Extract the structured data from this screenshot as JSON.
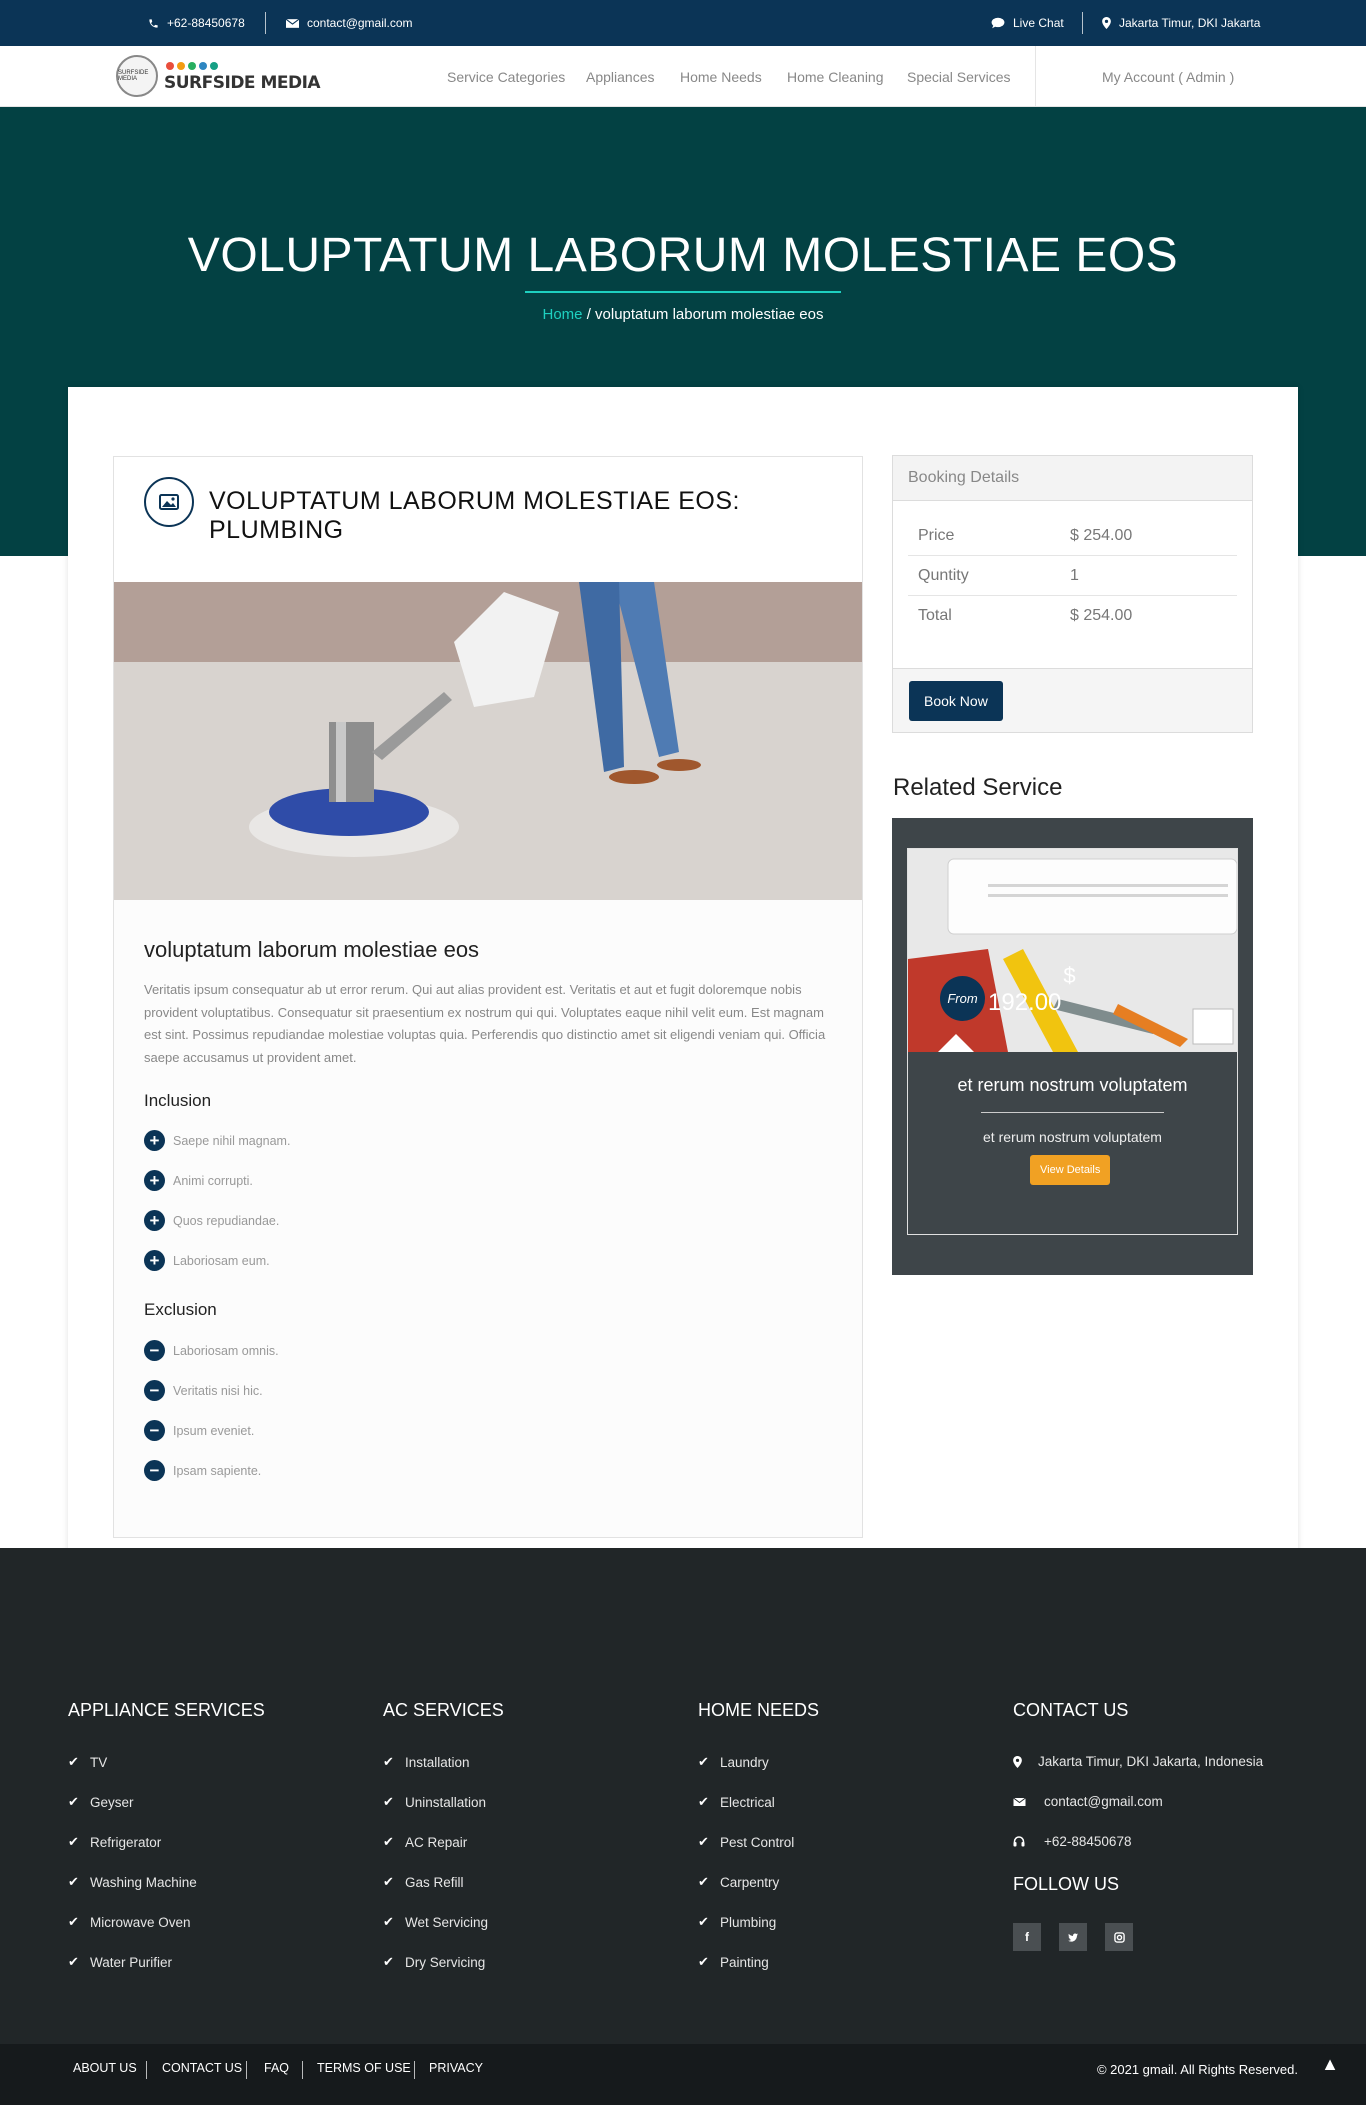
{
  "topbar": {
    "phone": "+62-88450678",
    "email": "contact@gmail.com",
    "live_chat": "Live Chat",
    "location": "Jakarta Timur, DKI Jakarta"
  },
  "brand": {
    "name": "SURFSIDE MEDIA",
    "badge": "SURFSIDE MEDIA"
  },
  "nav": {
    "items": [
      "Service Categories",
      "Appliances",
      "Home Needs",
      "Home Cleaning",
      "Special Services"
    ],
    "account": "My Account ( Admin )"
  },
  "hero": {
    "title": "VOLUPTATUM LABORUM MOLESTIAE EOS",
    "breadcrumb_home": "Home",
    "breadcrumb_current": "voluptatum laborum molestiae eos"
  },
  "service": {
    "title_line1": "VOLUPTATUM LABORUM MOLESTIAE EOS:",
    "title_line2": "PLUMBING",
    "subtitle": "voluptatum laborum molestiae eos",
    "description": "Veritatis ipsum consequatur ab ut error rerum. Qui aut alias provident est. Veritatis et aut et fugit doloremque nobis provident voluptatibus. Consequatur sit praesentium ex nostrum qui qui. Voluptates eaque nihil velit eum. Est magnam est sint. Possimus repudiandae molestiae voluptas quia. Perferendis quo distinctio amet sit eligendi veniam qui. Officia saepe accusamus ut provident amet.",
    "inclusion_title": "Inclusion",
    "inclusions": [
      "Saepe nihil magnam.",
      "Animi corrupti.",
      "Quos repudiandae.",
      "Laboriosam eum."
    ],
    "exclusion_title": "Exclusion",
    "exclusions": [
      "Laboriosam omnis.",
      "Veritatis nisi hic.",
      "Ipsum eveniet.",
      "Ipsam sapiente."
    ]
  },
  "booking": {
    "title": "Booking Details",
    "rows": [
      {
        "label": "Price",
        "value": "$ 254.00"
      },
      {
        "label": "Quntity",
        "value": "1"
      },
      {
        "label": "Total",
        "value": "$ 254.00"
      }
    ],
    "button": "Book Now"
  },
  "related": {
    "title": "Related Service",
    "from": "From",
    "price": "192.00",
    "currency": "$",
    "name": "et rerum nostrum voluptatem",
    "description": "et rerum nostrum voluptatem",
    "button": "View Details"
  },
  "footer": {
    "columns": [
      {
        "title": "APPLIANCE SERVICES",
        "items": [
          "TV",
          "Geyser",
          "Refrigerator",
          "Washing Machine",
          "Microwave Oven",
          "Water Purifier"
        ]
      },
      {
        "title": "AC SERVICES",
        "items": [
          "Installation",
          "Uninstallation",
          "AC Repair",
          "Gas Refill",
          "Wet Servicing",
          "Dry Servicing"
        ]
      },
      {
        "title": "HOME NEEDS",
        "items": [
          "Laundry",
          "Electrical",
          "Pest Control",
          "Carpentry",
          "Plumbing",
          "Painting"
        ]
      }
    ],
    "contact_title": "CONTACT US",
    "contact_address": "Jakarta Timur, DKI Jakarta, Indonesia",
    "contact_email": "contact@gmail.com",
    "contact_phone": "+62-88450678",
    "follow_title": "FOLLOW US",
    "social": [
      "f",
      "t",
      "i"
    ]
  },
  "bottom": {
    "links": [
      "ABOUT US",
      "CONTACT US",
      "FAQ",
      "TERMS OF USE",
      "PRIVACY"
    ],
    "copyright": "© 2021 gmail. All Rights Reserved."
  },
  "colors": {
    "navy": "#0b3456",
    "teal": "#034143",
    "accent": "#1ed0c0",
    "orange": "#f1a123",
    "footer": "#212628"
  }
}
